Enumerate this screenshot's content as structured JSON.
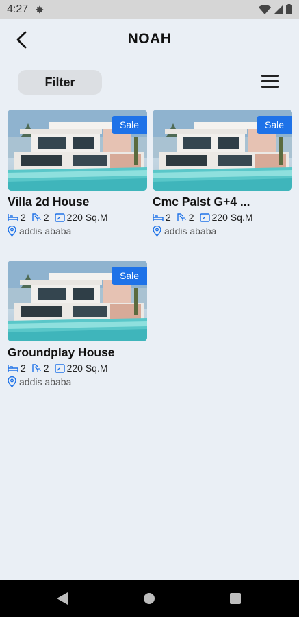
{
  "status_bar": {
    "time": "4:27"
  },
  "app_bar": {
    "title": "NOAH"
  },
  "filter": {
    "label": "Filter"
  },
  "listings": [
    {
      "title": "Villa 2d House",
      "badge": "Sale",
      "beds": "2",
      "baths": "2",
      "area": "220 Sq.M",
      "location": "addis ababa"
    },
    {
      "title": "Cmc Palst G+4 ...",
      "badge": "Sale",
      "beds": "2",
      "baths": "2",
      "area": "220 Sq.M",
      "location": "addis ababa"
    },
    {
      "title": "Groundplay House",
      "badge": "Sale",
      "beds": "2",
      "baths": "2",
      "area": "220 Sq.M",
      "location": "addis ababa"
    }
  ],
  "colors": {
    "accent": "#1e72e8",
    "background": "#eaeff5",
    "icon_blue": "#1e72e8"
  }
}
